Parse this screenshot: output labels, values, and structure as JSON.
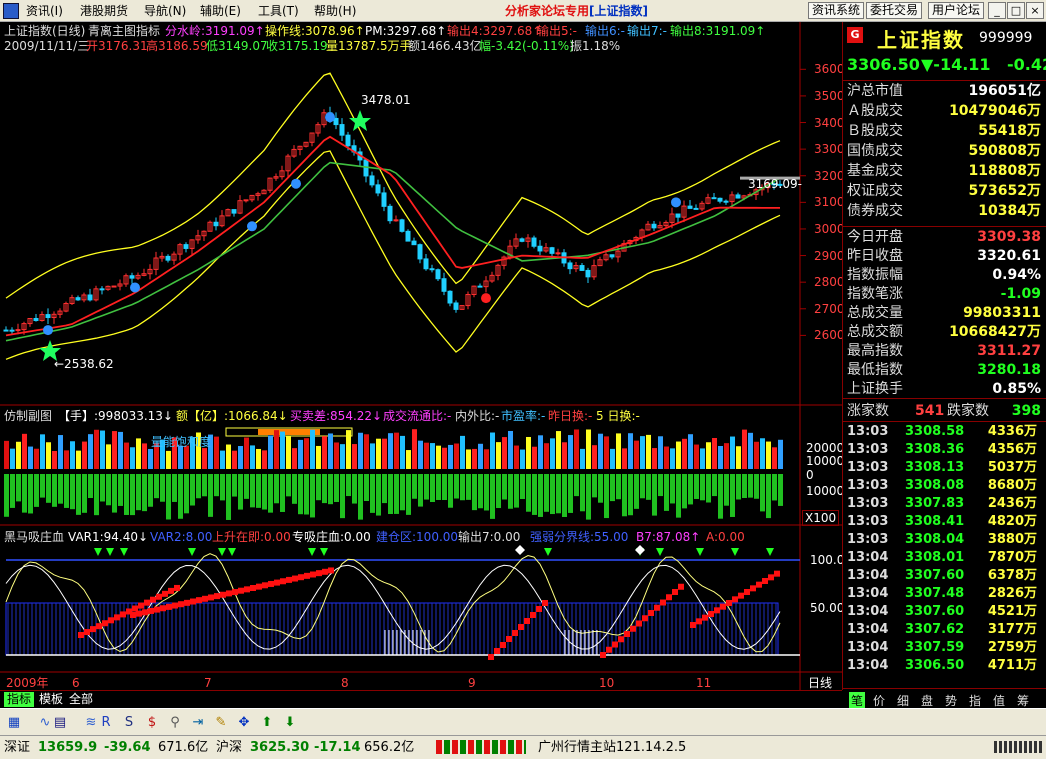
{
  "menu": {
    "items": [
      "资讯(I)",
      "港股期货",
      "导航(N)",
      "辅助(E)",
      "工具(T)",
      "帮助(H)"
    ],
    "center_prefix": "分析家论坛专用",
    "center_bracket": "[上证指数]",
    "right_buttons": [
      "资讯系统",
      "委托交易",
      "用户论坛"
    ],
    "window_controls": [
      "_",
      "□",
      "×"
    ]
  },
  "main_chart": {
    "line1": {
      "title": "上证指数(日线)",
      "indicator": "青离主图指标",
      "fs": "分水岭:3191.09↑",
      "cz": "操作线:3078.96↑",
      "pm": "PM:3297.68↑",
      "o4": "输出4:3297.68↑",
      "o5": "输出5:-",
      "o6": "输出6:-",
      "o7": "输出7:-",
      "o8": "输出8:3191.09↑"
    },
    "line2": {
      "date": "2009/11/11/三",
      "open": "开3176.31",
      "high": "高3186.59",
      "low": "低3149.07",
      "close": "收3175.19",
      "vol": "量13787.5万手",
      "amt": "额1466.43亿",
      "chg": "幅-3.42(-0.11%)",
      "amp": "振1.18%"
    },
    "price_ticks": [
      "3600",
      "3500",
      "3400",
      "3300",
      "3200",
      "3100",
      "3000",
      "2900",
      "2800",
      "2700",
      "2600"
    ],
    "annot_high": "3478.01",
    "annot_low": "←2538.62",
    "annot_last": "3169.09-",
    "marker_k": "K",
    "marker_m": "M"
  },
  "vol_panel": {
    "title": "仿制副图",
    "shou": "【手】:998033.13↓",
    "yi": "额【亿】:1066.84↓",
    "mm": "买卖差:854.22↓",
    "lt": "成交流通比:-",
    "nwb": "内外比:-",
    "syl": "市盈率:-",
    "zrh": "昨日换:-",
    "wrh": "5 日换:-",
    "label": "量能饱和度",
    "ticks": [
      "20000",
      "10000",
      "0",
      "10000"
    ],
    "scale": "X100"
  },
  "osc_panel": {
    "title": "黑马吸庄血",
    "var1": "VAR1:94.40↓",
    "var2": "VAR2:8.00",
    "ss": "上升在即:0.00",
    "zx": "专吸庄血:0.00",
    "jc": "建仓区:100.00",
    "o7": "输出7:0.00",
    "qr": "强弱分界线:55.00",
    "b7": "B7:87.08↑",
    "a": "A:0.00",
    "ticks": [
      "100.0",
      "50.00"
    ]
  },
  "time_axis": {
    "labels": [
      "2009年",
      "6",
      "7",
      "8",
      "9",
      "10",
      "11"
    ],
    "period": "日线"
  },
  "bottom_tabs": [
    "指标",
    "模板",
    "全部"
  ],
  "right_panel": {
    "name": "上证指数",
    "code": "999999",
    "g_badge": "G",
    "price": "3306.50",
    "change": "▼-14.11",
    "pct": "-0.42",
    "rows_a": [
      {
        "label": "沪总市值",
        "value": "196051亿",
        "color": "#ffffff"
      },
      {
        "label": "Ａ股成交",
        "value": "10479046万",
        "color": "#ffff40"
      },
      {
        "label": "Ｂ股成交",
        "value": "55418万",
        "color": "#ffff40"
      },
      {
        "label": "国债成交",
        "value": "590808万",
        "color": "#ffff40"
      },
      {
        "label": "基金成交",
        "value": "118808万",
        "color": "#ffff40"
      },
      {
        "label": "权证成交",
        "value": "573652万",
        "color": "#ffff40"
      },
      {
        "label": "债券成交",
        "value": "10384万",
        "color": "#ffff40"
      }
    ],
    "rows_b": [
      {
        "label": "今日开盘",
        "value": "3309.38",
        "color": "#ff4040"
      },
      {
        "label": "昨日收盘",
        "value": "3320.61",
        "color": "#ffffff"
      },
      {
        "label": "指数振幅",
        "value": "0.94%",
        "color": "#ffffff"
      },
      {
        "label": "指数笔涨",
        "value": "-1.09",
        "color": "#20ff20"
      },
      {
        "label": "总成交量",
        "value": "99803311",
        "color": "#ffff40"
      },
      {
        "label": "总成交额",
        "value": "10668427万",
        "color": "#ffff40"
      },
      {
        "label": "最高指数",
        "value": "3311.27",
        "color": "#ff4040"
      },
      {
        "label": "最低指数",
        "value": "3280.18",
        "color": "#20ff20"
      },
      {
        "label": "上证换手",
        "value": "0.85%",
        "color": "#ffffff"
      }
    ],
    "updown": {
      "up_label": "涨家数",
      "up": "541",
      "down_label": "跌家数",
      "down": "398"
    },
    "ticks": [
      [
        "13:03",
        "3308.58",
        "4336万"
      ],
      [
        "13:03",
        "3308.36",
        "4356万"
      ],
      [
        "13:03",
        "3308.13",
        "5037万"
      ],
      [
        "13:03",
        "3308.08",
        "8680万"
      ],
      [
        "13:03",
        "3307.83",
        "2436万"
      ],
      [
        "13:03",
        "3308.41",
        "4820万"
      ],
      [
        "13:03",
        "3308.04",
        "3880万"
      ],
      [
        "13:04",
        "3308.01",
        "7870万"
      ],
      [
        "13:04",
        "3307.60",
        "6378万"
      ],
      [
        "13:04",
        "3307.48",
        "2826万"
      ],
      [
        "13:04",
        "3307.60",
        "4521万"
      ],
      [
        "13:04",
        "3307.62",
        "3177万"
      ],
      [
        "13:04",
        "3307.59",
        "2759万"
      ],
      [
        "13:04",
        "3306.50",
        "4711万"
      ]
    ],
    "tabs": [
      "笔",
      "价",
      "细",
      "盘",
      "势",
      "指",
      "值",
      "筹"
    ]
  },
  "toolbar_icons": [
    "chart-icon",
    "dmi-icon",
    "eti-icon",
    "wave-icon",
    "rsi-icon",
    "sar-icon",
    "dollar-icon",
    "link-icon",
    "export-icon",
    "pen-icon",
    "move-icon",
    "up-arrow-icon",
    "down-arrow-icon"
  ],
  "status": {
    "sz_label": "深证",
    "sz_val": "13659.9",
    "sz_chg": "-39.64",
    "sz_amt": "671.6亿",
    "hs_label": "沪深",
    "hs_val": "3625.30",
    "hs_chg": "-17.14",
    "hs_amt": "656.2亿",
    "station": "广州行情主站121.14.2.5"
  },
  "chart_data": {
    "type": "line",
    "title": "上证指数(日线)",
    "x": [
      "2009-05-20",
      "2009-06-01",
      "2009-06-15",
      "2009-07-01",
      "2009-07-15",
      "2009-08-04",
      "2009-08-15",
      "2009-09-01",
      "2009-09-15",
      "2009-10-01",
      "2009-10-15",
      "2009-11-01",
      "2009-11-11"
    ],
    "series": [
      {
        "name": "close",
        "values": [
          2620,
          2720,
          2820,
          2980,
          3160,
          3440,
          3030,
          2700,
          2970,
          2830,
          3020,
          3110,
          3175
        ]
      },
      {
        "name": "操作线",
        "values": [
          2600,
          2640,
          2760,
          2920,
          3100,
          3350,
          3200,
          2850,
          2900,
          2890,
          2980,
          3080,
          3079
        ]
      },
      {
        "name": "分水岭",
        "values": [
          2580,
          2630,
          2720,
          2850,
          3000,
          3250,
          3220,
          3000,
          2880,
          2900,
          2950,
          3050,
          3191
        ]
      }
    ],
    "ylim": [
      2500,
      3650
    ]
  }
}
